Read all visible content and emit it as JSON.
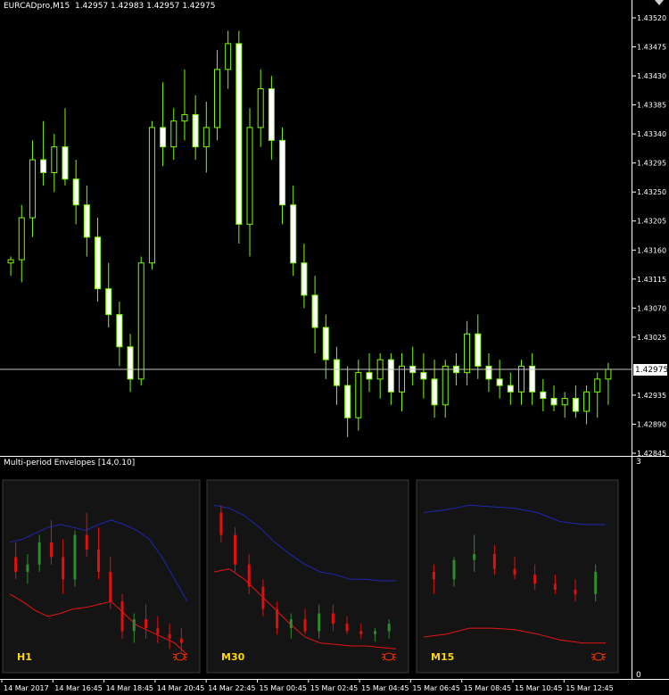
{
  "window": {
    "symbol_info": "EURCADpro,M15  1.42957 1.42983 1.42957 1.42975",
    "current_price": "1.42975",
    "bull_color": "#7CFC00",
    "bear_color": "#000000",
    "price_line_color": "#C0C0C0",
    "grid_color": "#FFFFFF"
  },
  "price_axis": {
    "labels": [
      "1.43520",
      "1.43475",
      "1.43430",
      "1.43385",
      "1.43340",
      "1.43295",
      "1.43250",
      "1.43205",
      "1.43160",
      "1.43115",
      "1.43070",
      "1.43025",
      "1.42935",
      "1.42890",
      "1.42845"
    ]
  },
  "chart_data": {
    "type": "candlestick",
    "symbol": "EURCADpro",
    "timeframe": "M15",
    "ylim": [
      1.42845,
      1.4352
    ],
    "current_price": 1.42975,
    "candles": [
      [
        1.4314,
        1.4315,
        1.4312,
        1.43145
      ],
      [
        1.43145,
        1.4323,
        1.4311,
        1.4321
      ],
      [
        1.4321,
        1.4333,
        1.4318,
        1.433
      ],
      [
        1.433,
        1.4336,
        1.4326,
        1.4328
      ],
      [
        1.4328,
        1.4334,
        1.4325,
        1.4332
      ],
      [
        1.4332,
        1.4338,
        1.4326,
        1.4327
      ],
      [
        1.4327,
        1.433,
        1.432,
        1.4323
      ],
      [
        1.4323,
        1.4326,
        1.4315,
        1.4318
      ],
      [
        1.4318,
        1.4321,
        1.4308,
        1.431
      ],
      [
        1.431,
        1.4314,
        1.4304,
        1.4306
      ],
      [
        1.4306,
        1.4308,
        1.4298,
        1.4301
      ],
      [
        1.4301,
        1.4303,
        1.4294,
        1.4296
      ],
      [
        1.4296,
        1.4315,
        1.4295,
        1.4314
      ],
      [
        1.4314,
        1.4336,
        1.4313,
        1.4335
      ],
      [
        1.4335,
        1.4342,
        1.4329,
        1.4332
      ],
      [
        1.4332,
        1.4338,
        1.433,
        1.4336
      ],
      [
        1.4336,
        1.4344,
        1.4333,
        1.4337
      ],
      [
        1.4337,
        1.434,
        1.433,
        1.4332
      ],
      [
        1.4332,
        1.4339,
        1.4328,
        1.4335
      ],
      [
        1.4335,
        1.4347,
        1.4333,
        1.4344
      ],
      [
        1.4344,
        1.435,
        1.4341,
        1.4348
      ],
      [
        1.4348,
        1.435,
        1.4317,
        1.432
      ],
      [
        1.432,
        1.4338,
        1.4315,
        1.4335
      ],
      [
        1.4335,
        1.4344,
        1.4332,
        1.4341
      ],
      [
        1.4341,
        1.4343,
        1.433,
        1.4333
      ],
      [
        1.4333,
        1.4335,
        1.432,
        1.4323
      ],
      [
        1.4323,
        1.4326,
        1.4312,
        1.4314
      ],
      [
        1.4314,
        1.4317,
        1.4307,
        1.4309
      ],
      [
        1.4309,
        1.4312,
        1.43,
        1.4304
      ],
      [
        1.4304,
        1.4306,
        1.4296,
        1.4299
      ],
      [
        1.4299,
        1.4301,
        1.4292,
        1.4295
      ],
      [
        1.4295,
        1.4298,
        1.4287,
        1.429
      ],
      [
        1.429,
        1.4299,
        1.4288,
        1.4297
      ],
      [
        1.4297,
        1.43,
        1.4294,
        1.4296
      ],
      [
        1.4296,
        1.43,
        1.4293,
        1.4299
      ],
      [
        1.4299,
        1.43,
        1.4292,
        1.4294
      ],
      [
        1.4294,
        1.43,
        1.4291,
        1.4298
      ],
      [
        1.4298,
        1.4301,
        1.4295,
        1.4297
      ],
      [
        1.4297,
        1.43,
        1.4293,
        1.4296
      ],
      [
        1.4296,
        1.4299,
        1.429,
        1.4292
      ],
      [
        1.4292,
        1.4299,
        1.429,
        1.4298
      ],
      [
        1.4298,
        1.43,
        1.4295,
        1.4297
      ],
      [
        1.4297,
        1.4305,
        1.4295,
        1.4303
      ],
      [
        1.4303,
        1.4306,
        1.4296,
        1.4298
      ],
      [
        1.4298,
        1.43,
        1.4294,
        1.4296
      ],
      [
        1.4296,
        1.4299,
        1.4293,
        1.4295
      ],
      [
        1.4295,
        1.4297,
        1.4292,
        1.4294
      ],
      [
        1.4294,
        1.4299,
        1.4292,
        1.4298
      ],
      [
        1.4298,
        1.43,
        1.4292,
        1.4294
      ],
      [
        1.4294,
        1.4296,
        1.4291,
        1.4293
      ],
      [
        1.4293,
        1.4295,
        1.4291,
        1.4292
      ],
      [
        1.4292,
        1.4294,
        1.429,
        1.4293
      ],
      [
        1.4293,
        1.4295,
        1.429,
        1.4291
      ],
      [
        1.4291,
        1.4295,
        1.4289,
        1.4294
      ],
      [
        1.4294,
        1.4297,
        1.429,
        1.4296
      ],
      [
        1.4296,
        1.42985,
        1.4292,
        1.42975
      ]
    ]
  },
  "indicator": {
    "title": "Multi-period Envelopes [14,0.10]",
    "axis_labels": [
      "3",
      "0"
    ],
    "panels": [
      {
        "label": "H1",
        "upper": [
          0.7,
          0.72,
          0.76,
          0.8,
          0.82,
          0.8,
          0.78,
          0.82,
          0.85,
          0.82,
          0.78,
          0.72,
          0.6,
          0.45,
          0.3
        ],
        "lower": [
          0.35,
          0.3,
          0.24,
          0.2,
          0.22,
          0.25,
          0.26,
          0.28,
          0.3,
          0.22,
          0.14,
          0.1,
          0.06,
          0.02,
          -0.06
        ],
        "candles": [
          [
            0.6,
            0.7,
            0.45,
            0.5
          ],
          [
            0.5,
            0.62,
            0.42,
            0.55
          ],
          [
            0.55,
            0.75,
            0.5,
            0.7
          ],
          [
            0.7,
            0.85,
            0.55,
            0.6
          ],
          [
            0.6,
            0.72,
            0.35,
            0.45
          ],
          [
            0.45,
            0.78,
            0.4,
            0.75
          ],
          [
            0.75,
            0.9,
            0.6,
            0.65
          ],
          [
            0.65,
            0.8,
            0.45,
            0.5
          ],
          [
            0.5,
            0.6,
            0.25,
            0.3
          ],
          [
            0.3,
            0.35,
            0.05,
            0.1
          ],
          [
            0.1,
            0.22,
            0.02,
            0.18
          ],
          [
            0.18,
            0.28,
            0.05,
            0.12
          ],
          [
            0.12,
            0.2,
            0.02,
            0.08
          ],
          [
            0.08,
            0.15,
            -0.02,
            0.05
          ],
          [
            0.05,
            0.12,
            -0.04,
            0.02
          ]
        ]
      },
      {
        "label": "M30",
        "upper": [
          0.95,
          0.93,
          0.88,
          0.8,
          0.7,
          0.62,
          0.55,
          0.5,
          0.48,
          0.45,
          0.45,
          0.44,
          0.44
        ],
        "lower": [
          0.5,
          0.52,
          0.45,
          0.35,
          0.25,
          0.15,
          0.06,
          0.02,
          0.01,
          0.0,
          0.0,
          -0.01,
          -0.02
        ],
        "candles": [
          [
            0.9,
            0.95,
            0.7,
            0.75
          ],
          [
            0.75,
            0.8,
            0.5,
            0.55
          ],
          [
            0.55,
            0.62,
            0.35,
            0.4
          ],
          [
            0.4,
            0.45,
            0.2,
            0.25
          ],
          [
            0.25,
            0.3,
            0.08,
            0.12
          ],
          [
            0.12,
            0.22,
            0.05,
            0.18
          ],
          [
            0.18,
            0.25,
            0.08,
            0.1
          ],
          [
            0.1,
            0.28,
            0.05,
            0.22
          ],
          [
            0.22,
            0.28,
            0.1,
            0.15
          ],
          [
            0.15,
            0.2,
            0.08,
            0.1
          ],
          [
            0.1,
            0.15,
            0.05,
            0.08
          ],
          [
            0.08,
            0.12,
            0.03,
            0.1
          ],
          [
            0.1,
            0.18,
            0.05,
            0.15
          ]
        ]
      },
      {
        "label": "M15",
        "upper": [
          0.9,
          0.92,
          0.95,
          0.94,
          0.93,
          0.9,
          0.84,
          0.82,
          0.82
        ],
        "lower": [
          0.06,
          0.08,
          0.12,
          0.12,
          0.11,
          0.08,
          0.04,
          0.02,
          0.02
        ],
        "candles": [
          [
            0.5,
            0.55,
            0.35,
            0.45
          ],
          [
            0.45,
            0.6,
            0.4,
            0.58
          ],
          [
            0.58,
            0.75,
            0.5,
            0.62
          ],
          [
            0.62,
            0.68,
            0.48,
            0.52
          ],
          [
            0.52,
            0.6,
            0.45,
            0.48
          ],
          [
            0.48,
            0.55,
            0.38,
            0.42
          ],
          [
            0.42,
            0.48,
            0.35,
            0.38
          ],
          [
            0.38,
            0.45,
            0.3,
            0.35
          ],
          [
            0.35,
            0.55,
            0.3,
            0.5
          ]
        ]
      }
    ],
    "upper_color": "#1E28B4",
    "lower_color": "#E61414",
    "bull_color": "#2E8B2E",
    "bear_color": "#E01010",
    "label_color": "#FFD700",
    "bug_icon_color": "#FF3300"
  },
  "time_axis": {
    "labels": [
      "14 Mar 2017",
      "14 Mar 16:45",
      "14 Mar 18:45",
      "14 Mar 20:45",
      "14 Mar 22:45",
      "15 Mar 00:45",
      "15 Mar 02:45",
      "15 Mar 04:45",
      "15 Mar 06:45",
      "15 Mar 08:45",
      "15 Mar 10:45",
      "15 Mar 12:45"
    ]
  }
}
